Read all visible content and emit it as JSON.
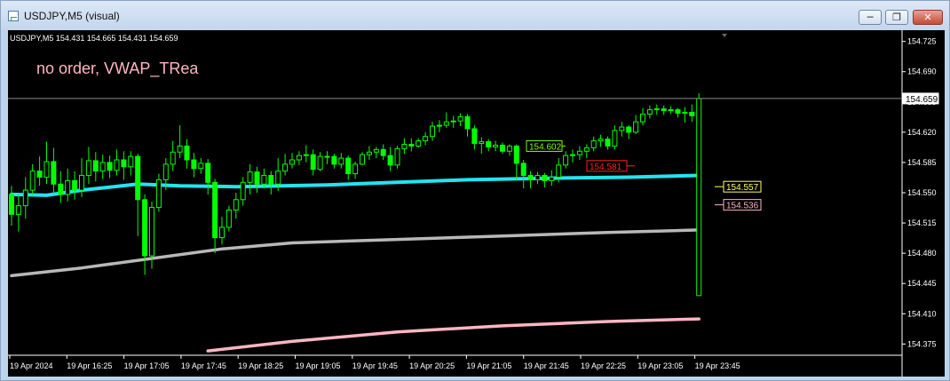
{
  "window": {
    "title": "USDJPY,M5 (visual)",
    "controls": {
      "minimize_icon": "minimize-icon",
      "restore_icon": "restore-icon",
      "close_icon": "close-icon"
    }
  },
  "chart_header": {
    "symbol_ohlc": "USDJPY,M5  154.431 154.665 154.431 154.659",
    "status_text": "no order, VWAP_TRea"
  },
  "colors": {
    "background": "#000000",
    "candle": "#00ff00",
    "vwap": "#22e4f0",
    "grey_band": "#b8b8b8",
    "pink_band": "#ffb6c1",
    "label_green": "#7cfc00",
    "label_red": "#ff2020",
    "label_yellow": "#ffff66",
    "label_pink": "#ffb6c1",
    "axis_text": "#ffffff"
  },
  "chart_data": {
    "type": "candlestick",
    "y_axis": {
      "range": [
        154.362,
        154.738
      ],
      "ticks": [
        "154.725",
        "154.690",
        "154.655",
        "154.620",
        "154.585",
        "154.550",
        "154.515",
        "154.480",
        "154.445",
        "154.410",
        "154.375"
      ]
    },
    "x_axis": {
      "ticks": [
        "19 Apr 2024",
        "19 Apr 16:25",
        "19 Apr 17:05",
        "19 Apr 17:45",
        "19 Apr 18:25",
        "19 Apr 19:05",
        "19 Apr 19:45",
        "19 Apr 20:25",
        "19 Apr 21:05",
        "19 Apr 21:45",
        "19 Apr 22:25",
        "19 Apr 23:05",
        "19 Apr 23:45"
      ]
    },
    "candles": [
      [
        154.548,
        154.525,
        154.558,
        154.512
      ],
      [
        154.525,
        154.535,
        154.548,
        154.505
      ],
      [
        154.535,
        154.553,
        154.568,
        154.52
      ],
      [
        154.553,
        154.575,
        154.583,
        154.547
      ],
      [
        154.575,
        154.568,
        154.592,
        154.558
      ],
      [
        154.568,
        154.586,
        154.609,
        154.56
      ],
      [
        154.586,
        154.56,
        154.602,
        154.548
      ],
      [
        154.56,
        154.548,
        154.575,
        154.538
      ],
      [
        154.548,
        154.564,
        154.578,
        154.54
      ],
      [
        154.564,
        154.553,
        154.575,
        154.542
      ],
      [
        154.553,
        154.57,
        154.59,
        154.545
      ],
      [
        154.57,
        154.587,
        154.603,
        154.56
      ],
      [
        154.587,
        154.575,
        154.597,
        154.563
      ],
      [
        154.575,
        154.585,
        154.594,
        154.566
      ],
      [
        154.585,
        154.576,
        154.593,
        154.567
      ],
      [
        154.576,
        154.588,
        154.6,
        154.57
      ],
      [
        154.588,
        154.58,
        154.598,
        154.565
      ],
      [
        154.58,
        154.592,
        154.598,
        154.57
      ],
      [
        154.592,
        154.542,
        154.595,
        154.5
      ],
      [
        154.542,
        154.477,
        154.548,
        154.455
      ],
      [
        154.477,
        154.533,
        154.54,
        154.462
      ],
      [
        154.533,
        154.565,
        154.572,
        154.528
      ],
      [
        154.565,
        154.583,
        154.59,
        154.553
      ],
      [
        154.583,
        154.597,
        154.61,
        154.575
      ],
      [
        154.597,
        154.604,
        154.628,
        154.59
      ],
      [
        154.604,
        154.588,
        154.612,
        154.578
      ],
      [
        154.588,
        154.578,
        154.596,
        154.568
      ],
      [
        154.578,
        154.584,
        154.59,
        154.572
      ],
      [
        154.584,
        154.562,
        154.589,
        154.548
      ],
      [
        154.562,
        154.498,
        154.566,
        154.48
      ],
      [
        154.498,
        154.51,
        154.522,
        154.49
      ],
      [
        154.51,
        154.53,
        154.535,
        154.505
      ],
      [
        154.53,
        154.542,
        154.55,
        154.52
      ],
      [
        154.542,
        154.562,
        154.568,
        154.535
      ],
      [
        154.562,
        154.574,
        154.583,
        154.548
      ],
      [
        154.574,
        154.56,
        154.58,
        154.55
      ],
      [
        154.56,
        154.57,
        154.578,
        154.555
      ],
      [
        154.57,
        154.56,
        154.575,
        154.548
      ],
      [
        154.56,
        154.575,
        154.59,
        154.552
      ],
      [
        154.575,
        154.583,
        154.595,
        154.57
      ],
      [
        154.583,
        154.588,
        154.596,
        154.578
      ],
      [
        154.588,
        154.593,
        154.598,
        154.582
      ],
      [
        154.593,
        154.594,
        154.605,
        154.585
      ],
      [
        154.594,
        154.577,
        154.6,
        154.57
      ],
      [
        154.577,
        154.592,
        154.597,
        154.575
      ],
      [
        154.592,
        154.592,
        154.598,
        154.583
      ],
      [
        154.592,
        154.583,
        154.595,
        154.578
      ],
      [
        154.583,
        154.59,
        154.596,
        154.578
      ],
      [
        154.59,
        154.572,
        154.593,
        154.565
      ],
      [
        154.572,
        154.583,
        154.586,
        154.566
      ],
      [
        154.583,
        154.594,
        154.597,
        154.582
      ],
      [
        154.594,
        154.597,
        154.604,
        154.588
      ],
      [
        154.597,
        154.6,
        154.603,
        154.59
      ],
      [
        154.6,
        154.593,
        154.606,
        154.588
      ],
      [
        154.593,
        154.582,
        154.603,
        154.575
      ],
      [
        154.582,
        154.601,
        154.604,
        154.578
      ],
      [
        154.601,
        154.606,
        154.613,
        154.595
      ],
      [
        154.606,
        154.604,
        154.613,
        154.598
      ],
      [
        154.604,
        154.61,
        154.613,
        154.602
      ],
      [
        154.61,
        154.615,
        154.62,
        154.605
      ],
      [
        154.615,
        154.627,
        154.632,
        154.61
      ],
      [
        154.627,
        154.628,
        154.634,
        154.62
      ],
      [
        154.628,
        154.632,
        154.643,
        154.625
      ],
      [
        154.632,
        154.633,
        154.639,
        154.625
      ],
      [
        154.633,
        154.638,
        154.642,
        154.627
      ],
      [
        154.638,
        154.624,
        154.641,
        154.615
      ],
      [
        154.624,
        154.607,
        154.628,
        154.6
      ],
      [
        154.607,
        154.609,
        154.614,
        154.595
      ],
      [
        154.609,
        154.603,
        154.612,
        154.598
      ],
      [
        154.603,
        154.605,
        154.61,
        154.598
      ],
      [
        154.605,
        154.598,
        154.608,
        154.595
      ],
      [
        154.598,
        154.604,
        154.606,
        154.593
      ],
      [
        154.604,
        154.584,
        154.606,
        154.565
      ],
      [
        154.584,
        154.57,
        154.588,
        154.555
      ],
      [
        154.57,
        154.565,
        154.575,
        154.555
      ],
      [
        154.565,
        154.57,
        154.574,
        154.56
      ],
      [
        154.57,
        154.564,
        154.573,
        154.556
      ],
      [
        154.564,
        154.568,
        154.576,
        154.558
      ],
      [
        154.568,
        154.582,
        154.59,
        154.562
      ],
      [
        154.582,
        154.593,
        154.598,
        154.578
      ],
      [
        154.593,
        154.594,
        154.6,
        154.585
      ],
      [
        154.594,
        154.598,
        154.604,
        154.588
      ],
      [
        154.598,
        154.602,
        154.606,
        154.59
      ],
      [
        154.602,
        154.61,
        154.615,
        154.598
      ],
      [
        154.61,
        154.612,
        154.617,
        154.603
      ],
      [
        154.612,
        154.604,
        154.615,
        154.6
      ],
      [
        154.604,
        154.622,
        154.628,
        154.6
      ],
      [
        154.622,
        154.626,
        154.632,
        154.615
      ],
      [
        154.626,
        154.62,
        154.628,
        154.612
      ],
      [
        154.62,
        154.632,
        154.64,
        154.618
      ],
      [
        154.632,
        154.641,
        154.648,
        154.628
      ],
      [
        154.641,
        154.646,
        154.651,
        154.636
      ],
      [
        154.646,
        154.647,
        154.652,
        154.64
      ],
      [
        154.647,
        154.645,
        154.651,
        154.64
      ],
      [
        154.645,
        154.646,
        154.65,
        154.641
      ],
      [
        154.646,
        154.642,
        154.648,
        154.637
      ],
      [
        154.642,
        154.643,
        154.649,
        154.631
      ],
      [
        154.643,
        154.639,
        154.652,
        154.632
      ],
      [
        154.431,
        154.659,
        154.665,
        154.431
      ]
    ],
    "series": [
      {
        "name": "",
        "color": "#22e4f0",
        "points": [
          [
            0,
            154.548
          ],
          [
            5,
            154.547
          ],
          [
            10,
            154.553
          ],
          [
            18,
            154.56
          ],
          [
            24,
            154.558
          ],
          [
            32,
            154.557
          ],
          [
            45,
            154.559
          ],
          [
            55,
            154.562
          ],
          [
            65,
            154.565
          ],
          [
            78,
            154.567
          ],
          [
            88,
            154.568
          ],
          [
            98,
            154.57
          ]
        ]
      },
      {
        "name": "",
        "color": "#b8b8b8",
        "points": [
          [
            0,
            154.454
          ],
          [
            10,
            154.463
          ],
          [
            20,
            154.474
          ],
          [
            30,
            154.485
          ],
          [
            40,
            154.492
          ],
          [
            55,
            154.496
          ],
          [
            70,
            154.5
          ],
          [
            85,
            154.504
          ],
          [
            98,
            154.507
          ]
        ]
      },
      {
        "name": "",
        "color": "#ffb6c1",
        "points": [
          [
            28,
            154.367
          ],
          [
            40,
            154.378
          ],
          [
            55,
            154.389
          ],
          [
            70,
            154.396
          ],
          [
            85,
            154.401
          ],
          [
            98,
            154.404
          ]
        ]
      }
    ],
    "price_labels": [
      {
        "text": "154.602",
        "value": 154.604
      },
      {
        "text": "154.581",
        "value": 154.581
      },
      {
        "text": "154.557",
        "value": 154.557
      },
      {
        "text": "154.536",
        "value": 154.536
      },
      {
        "text": "154.659",
        "value": 154.659
      }
    ]
  }
}
